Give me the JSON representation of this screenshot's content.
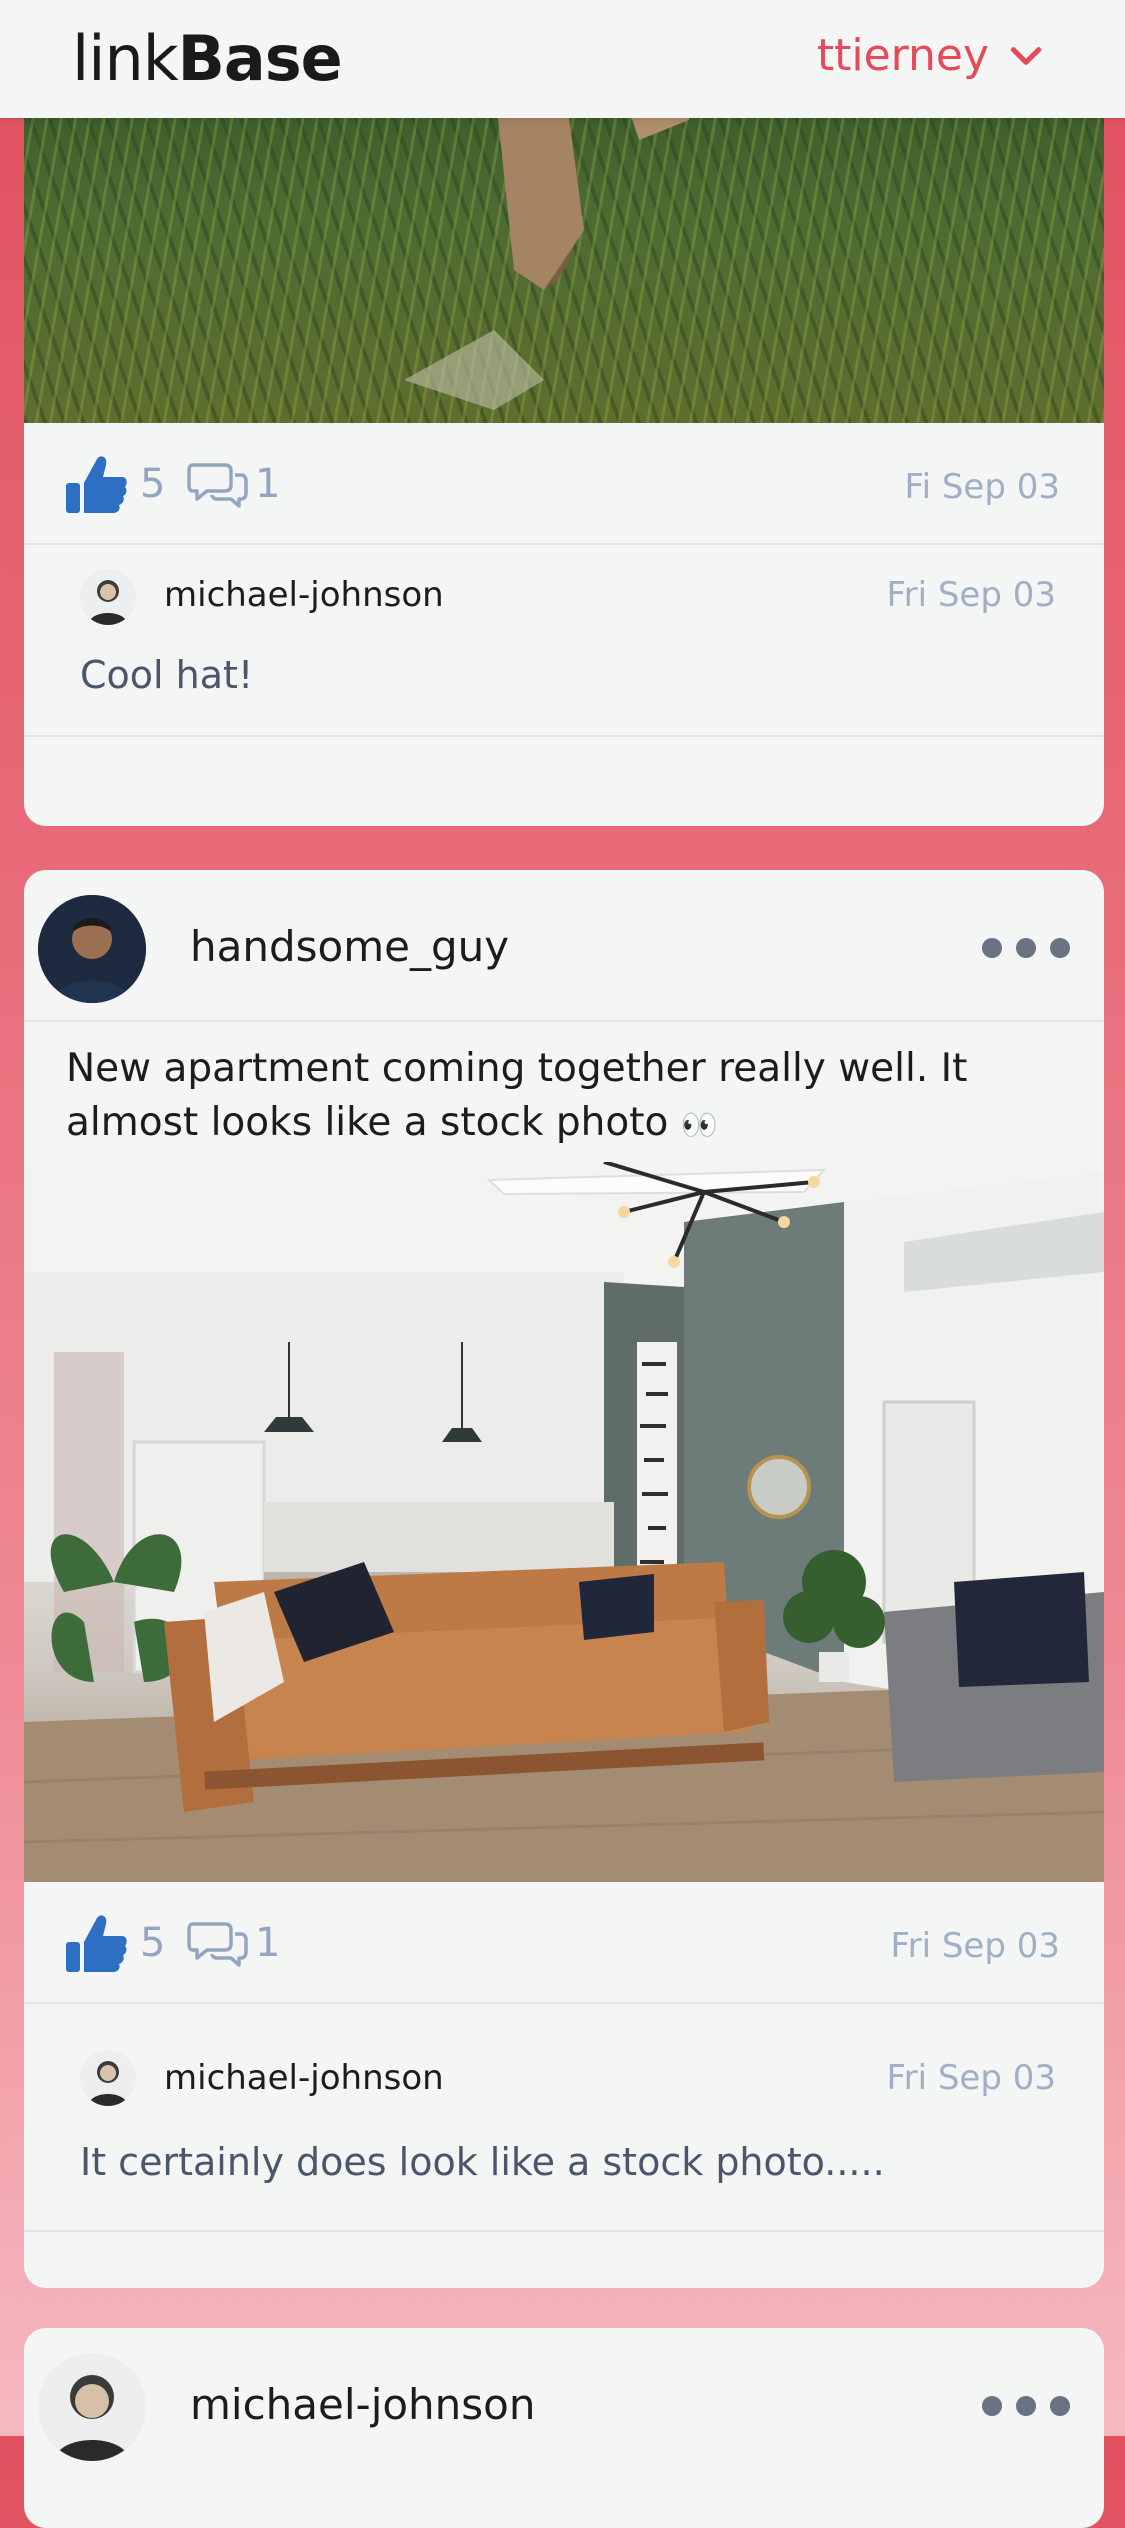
{
  "header": {
    "logo_light": "link",
    "logo_bold": "Base",
    "username": "ttierney"
  },
  "colors": {
    "accent": "#e44a5a",
    "like_blue": "#2c6fc3",
    "muted": "#9fb0c6"
  },
  "posts": [
    {
      "likes": "5",
      "comments": "1",
      "date": "Fi Sep 03",
      "comment_items": [
        {
          "user": "michael-johnson",
          "date": "Fri Sep 03",
          "text": "Cool hat!"
        }
      ]
    },
    {
      "user": "handsome_guy",
      "caption": "New apartment coming together really well. It almost looks like a stock photo",
      "caption_emoji": "👀",
      "likes": "5",
      "comments": "1",
      "date": "Fri Sep 03",
      "comment_items": [
        {
          "user": "michael-johnson",
          "date": "Fri Sep 03",
          "text": "It certainly does look like a stock photo....."
        }
      ]
    },
    {
      "user": "michael-johnson"
    }
  ]
}
